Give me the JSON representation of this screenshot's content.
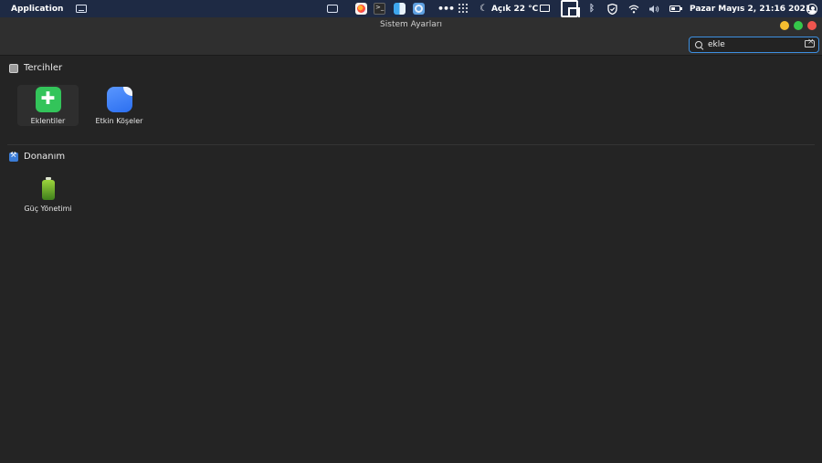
{
  "topbar": {
    "apple_glyph": "",
    "app_name": "Application",
    "weather": "Açık 22 °C",
    "clock": "Pazar Mayıs  2, 21:16 2021"
  },
  "window": {
    "title": "Sistem Ayarları"
  },
  "search": {
    "value": "ekle",
    "placeholder": ""
  },
  "sections": [
    {
      "title": "Tercihler",
      "items": [
        {
          "label": "Eklentiler",
          "icon": "puzzle-icon",
          "selected": true
        },
        {
          "label": "Etkin Köşeler",
          "icon": "corner-icon",
          "selected": false
        }
      ]
    },
    {
      "title": "Donanım",
      "items": [
        {
          "label": "Güç Yönetimi",
          "icon": "battery-icon",
          "selected": false
        }
      ]
    }
  ],
  "colors": {
    "panel": "#1e2a44",
    "window_bg": "#242424",
    "header_bg": "#2f2f2f",
    "accent": "#3d8fe0",
    "close": "#f0554e",
    "minimize": "#f5be30",
    "maximize": "#35c84a"
  }
}
